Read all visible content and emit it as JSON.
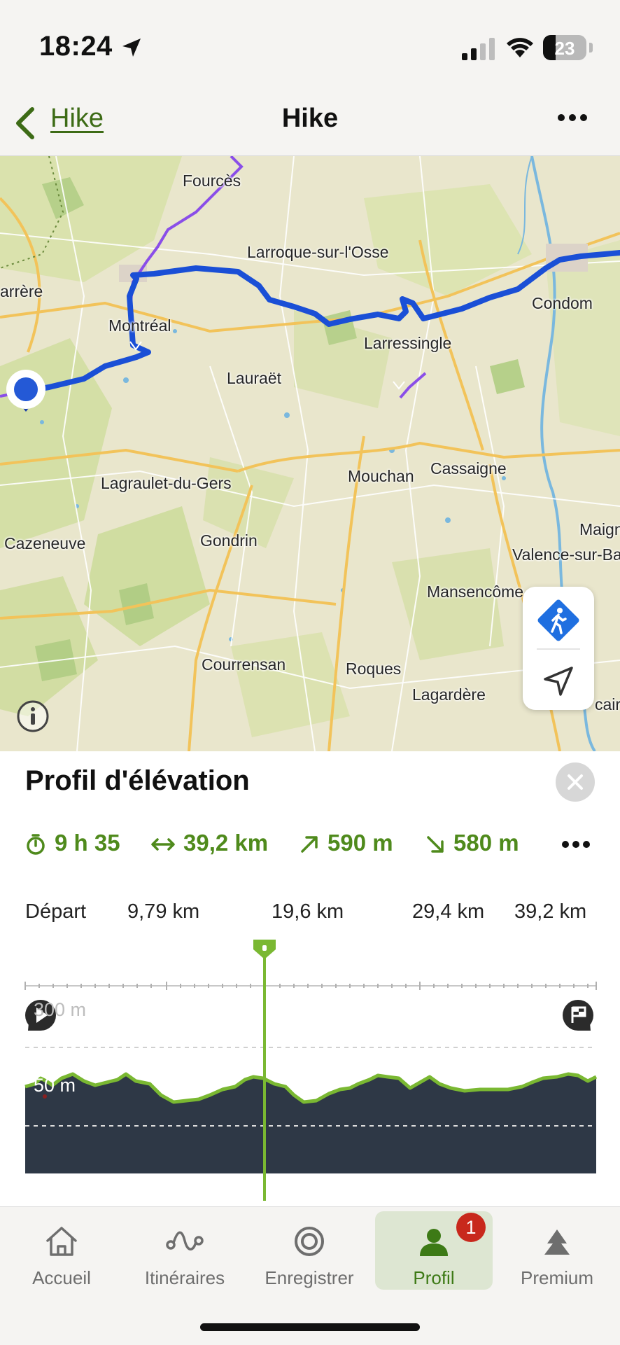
{
  "status": {
    "time": "18:24",
    "battery": "23"
  },
  "nav": {
    "back_label": "Hike",
    "title": "Hike"
  },
  "map": {
    "places": [
      "Fourcès",
      "Larroque-sur-l'Osse",
      "arrère",
      "Condom",
      "Montréal",
      "Larressingle",
      "Lauraët",
      "Mouchan",
      "Cassaigne",
      "Lagraulet-du-Gers",
      "Cazeneuve",
      "Gondrin",
      "Maign",
      "Valence-sur-Ba",
      "Mansencôme",
      "Courrensan",
      "Roques",
      "Lagardère",
      "caire"
    ],
    "route_color": "#1a4fd6",
    "alt_route_color": "#8a4ee8",
    "controls": {
      "activity": "hiker-icon",
      "locate": "navigation-arrow-icon"
    }
  },
  "elevation": {
    "title": "Profil d'élévation",
    "stats": {
      "duration": "9 h 35",
      "distance": "39,2 km",
      "ascent": "590 m",
      "descent": "580 m"
    },
    "axis": [
      "Départ",
      "9,79 km",
      "19,6 km",
      "29,4 km",
      "39,2 km"
    ],
    "elev_labels": {
      "top": "300 m",
      "bottom": "50 m"
    },
    "accent_color": "#7ab832",
    "fill_color": "#2e3846",
    "cursor_km": "19,6 km"
  },
  "tabs": [
    {
      "label": "Accueil",
      "icon": "home-icon"
    },
    {
      "label": "Itinéraires",
      "icon": "route-icon"
    },
    {
      "label": "Enregistrer",
      "icon": "record-icon"
    },
    {
      "label": "Profil",
      "icon": "profile-icon",
      "badge": "1",
      "active": true
    },
    {
      "label": "Premium",
      "icon": "premium-icon"
    }
  ]
}
